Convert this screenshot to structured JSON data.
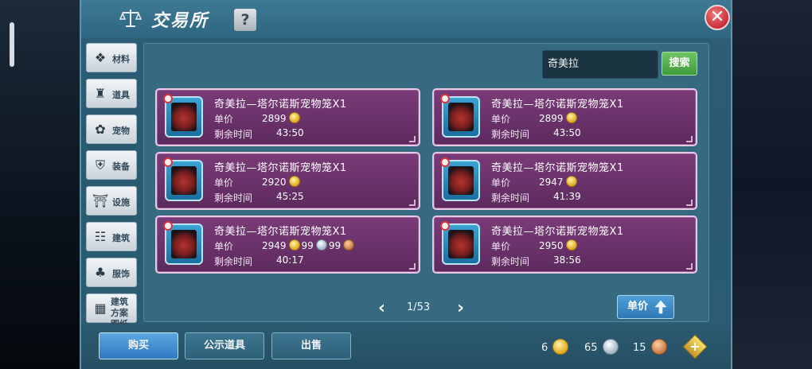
{
  "header": {
    "title": "交易所",
    "help_label": "?",
    "close_label": "✕"
  },
  "sidebar": {
    "items": [
      {
        "label": "材料",
        "icon": "materials-icon",
        "glyph": "❖"
      },
      {
        "label": "道具",
        "icon": "potion-icon",
        "glyph": "♜"
      },
      {
        "label": "宠物",
        "icon": "paw-icon",
        "glyph": "✿"
      },
      {
        "label": "装备",
        "icon": "shield-icon",
        "glyph": "⛨"
      },
      {
        "label": "设施",
        "icon": "facility-icon",
        "glyph": "⛩"
      },
      {
        "label": "建筑",
        "icon": "building-icon",
        "glyph": "☷"
      },
      {
        "label": "服饰",
        "icon": "clothing-icon",
        "glyph": "♣"
      },
      {
        "label": "建筑方案图纸",
        "icon": "blueprint-icon",
        "glyph": "▦"
      }
    ]
  },
  "search": {
    "value": "奇美拉",
    "button_label": "搜索"
  },
  "listings": [
    {
      "name": "奇美拉—塔尔诺斯宠物笼X1",
      "price_label": "单价",
      "price": "2899",
      "time_label": "剩余时间",
      "time": "43:50"
    },
    {
      "name": "奇美拉—塔尔诺斯宠物笼X1",
      "price_label": "单价",
      "price": "2899",
      "time_label": "剩余时间",
      "time": "43:50"
    },
    {
      "name": "奇美拉—塔尔诺斯宠物笼X1",
      "price_label": "单价",
      "price": "2920",
      "time_label": "剩余时间",
      "time": "45:25"
    },
    {
      "name": "奇美拉—塔尔诺斯宠物笼X1",
      "price_label": "单价",
      "price": "2947",
      "time_label": "剩余时间",
      "time": "41:39"
    },
    {
      "name": "奇美拉—塔尔诺斯宠物笼X1",
      "price_label": "单价",
      "price": "2949",
      "price_silver": "99",
      "price_copper": "99",
      "time_label": "剩余时间",
      "time": "40:17"
    },
    {
      "name": "奇美拉—塔尔诺斯宠物笼X1",
      "price_label": "单价",
      "price": "2950",
      "time_label": "剩余时间",
      "time": "38:56"
    }
  ],
  "pagination": {
    "prev": "‹",
    "page": "1/53",
    "next": "›"
  },
  "sort": {
    "label": "单价"
  },
  "bottom_tabs": {
    "buy": "购买",
    "public": "公示道具",
    "sell": "出售"
  },
  "currency": {
    "gold": "6",
    "silver": "65",
    "copper": "15",
    "add_label": "+"
  },
  "colors": {
    "gold": "#e0a820",
    "silver": "#9fb4c4",
    "copper": "#c77a3f",
    "card": "#6b3168",
    "accent_green": "#4faf48"
  }
}
